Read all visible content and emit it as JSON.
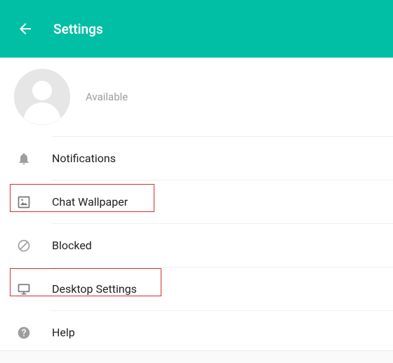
{
  "header": {
    "title": "Settings"
  },
  "profile": {
    "status": "Available"
  },
  "items": [
    {
      "label": "Notifications",
      "icon": "bell"
    },
    {
      "label": "Chat Wallpaper",
      "icon": "wallpaper"
    },
    {
      "label": "Blocked",
      "icon": "blocked"
    },
    {
      "label": "Desktop Settings",
      "icon": "desktop"
    },
    {
      "label": "Help",
      "icon": "help"
    }
  ]
}
